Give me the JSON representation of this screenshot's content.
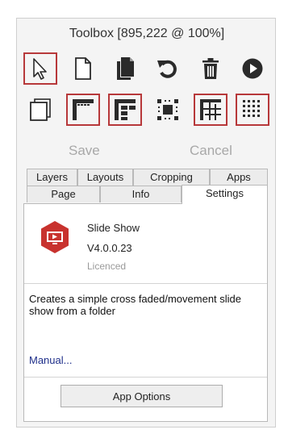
{
  "window": {
    "title": "Toolbox [895,222 @ 100%]"
  },
  "toolbar": {
    "row1": [
      {
        "icon": "pointer-icon",
        "selected": true
      },
      {
        "icon": "new-page-icon",
        "selected": false
      },
      {
        "icon": "copy-pages-icon",
        "selected": false
      },
      {
        "icon": "undo-icon",
        "selected": false
      },
      {
        "icon": "trash-icon",
        "selected": false
      },
      {
        "icon": "play-icon",
        "selected": false
      }
    ],
    "row2": [
      {
        "icon": "page-frame-icon",
        "selected": false
      },
      {
        "icon": "corner-frame-icon",
        "selected": true
      },
      {
        "icon": "tiled-frame-icon",
        "selected": true
      },
      {
        "icon": "dotted-square-icon",
        "selected": false
      },
      {
        "icon": "grid-frame-icon",
        "selected": true
      },
      {
        "icon": "dot-grid-icon",
        "selected": true
      }
    ],
    "save_label": "Save",
    "cancel_label": "Cancel"
  },
  "tabs": {
    "back_row": [
      "Layers",
      "Layouts",
      "Cropping",
      "Apps"
    ],
    "front_row": [
      "Page",
      "Info",
      "Settings"
    ],
    "active": "Settings"
  },
  "app": {
    "icon": "slideshow-app-icon",
    "name": "Slide Show",
    "version": "V4.0.0.23",
    "license": "Licenced",
    "description": "Creates a simple cross faded/movement slide show from a folder",
    "manual_link": "Manual...",
    "options_button": "App Options"
  },
  "colors": {
    "selection_border": "#b7383a",
    "app_icon": "#c8322e",
    "link": "#1f2f8a"
  }
}
